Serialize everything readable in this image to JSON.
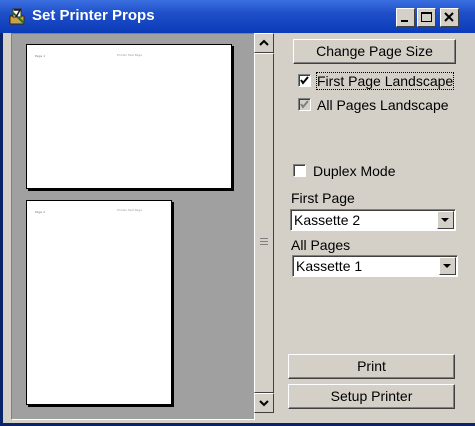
{
  "window": {
    "title": "Set Printer Props",
    "minimize_icon": "minimize-icon",
    "maximize_icon": "maximize-icon",
    "close_icon": "close-icon",
    "app_icon": "printer-app-icon"
  },
  "preview": {
    "pages": [
      {
        "orientation": "landscape",
        "header_left": "Page 1",
        "header_center": "Printer Test Page"
      },
      {
        "orientation": "portrait",
        "header_left": "Page 2",
        "header_center": "Printer Test Page"
      }
    ]
  },
  "controls": {
    "change_page_size": "Change Page Size",
    "first_page_landscape": {
      "label": "First Page Landscape",
      "checked": true
    },
    "all_pages_landscape": {
      "label": "All Pages Landscape",
      "checked": true,
      "disabled": true
    },
    "duplex_mode": {
      "label": "Duplex Mode",
      "checked": false
    },
    "first_page": {
      "label": "First Page",
      "value": "Kassette 2"
    },
    "all_pages": {
      "label": "All Pages",
      "value": "Kassette 1"
    },
    "print": "Print",
    "setup_printer": "Setup Printer"
  }
}
